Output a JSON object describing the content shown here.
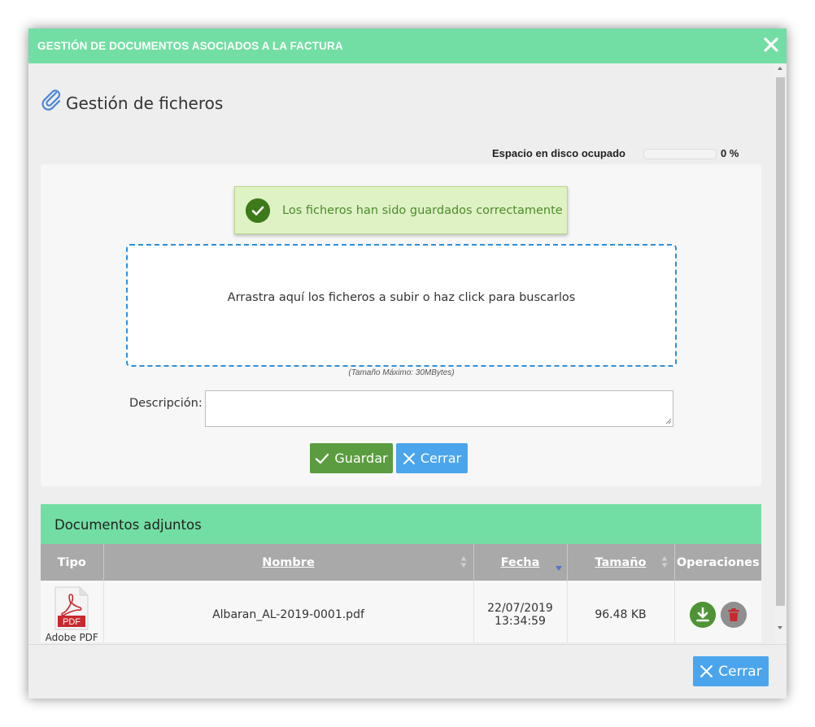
{
  "modal": {
    "title": "GESTIÓN DE DOCUMENTOS ASOCIADOS A LA FACTURA",
    "close_icon": "close-icon"
  },
  "files_section": {
    "title": "Gestión de ficheros",
    "icon": "paperclip-icon"
  },
  "disk_space": {
    "label": "Espacio en disco ocupado",
    "percent_text": "0 %",
    "percent_value": 0
  },
  "alert": {
    "message": "Los ficheros han sido guardados correctamente",
    "icon": "check-circle-icon",
    "color": "#4c8b2b"
  },
  "dropzone": {
    "text": "Arrastra aquí los ficheros a subir o haz click para buscarlos",
    "max_size": "(Tamaño Máximo: 30MBytes)"
  },
  "description": {
    "label": "Descripción:",
    "value": ""
  },
  "buttons": {
    "save": "Guardar",
    "cancel": "Cerrar",
    "footer_close": "Cerrar"
  },
  "documents": {
    "title": "Documentos adjuntos",
    "columns": [
      "Tipo",
      "Nombre",
      "Fecha",
      "Tamaño",
      "Operaciones"
    ],
    "rows": [
      {
        "type_label": "PDF",
        "type_caption": "Adobe PDF",
        "name": "Albaran_AL-2019-0001.pdf",
        "date": "22/07/2019",
        "time": "13:34:59",
        "size": "96.48 KB"
      }
    ]
  },
  "colors": {
    "header": "#72dea3",
    "save_button": "#5a9c3f",
    "close_button": "#4ba5ec",
    "table_header": "#a9a9a9"
  }
}
